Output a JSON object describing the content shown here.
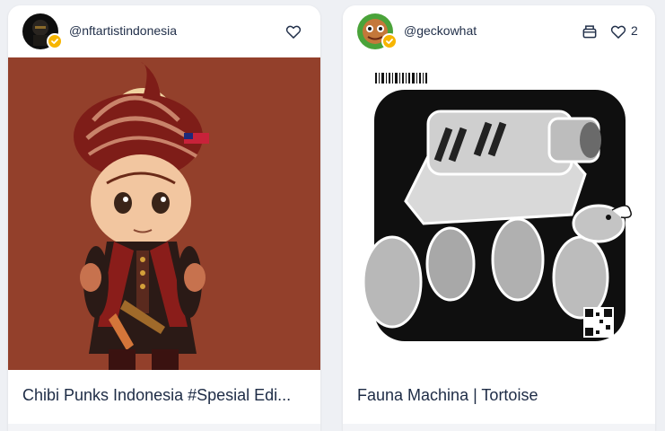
{
  "cards": [
    {
      "username": "@nftartistindonesia",
      "title": "Chibi Punks Indonesia #Spesial Edi...",
      "verified": true,
      "favorited": false,
      "media_bg": "#93402b"
    },
    {
      "username": "@geckowhat",
      "title": "Fauna Machina | Tortoise",
      "verified": true,
      "favorited": false,
      "favorite_count": "2",
      "media_bg": "#ffffff"
    }
  ],
  "colors": {
    "page_bg": "#eef0f4",
    "text": "#22304a",
    "verified_badge": "#f7b500"
  }
}
